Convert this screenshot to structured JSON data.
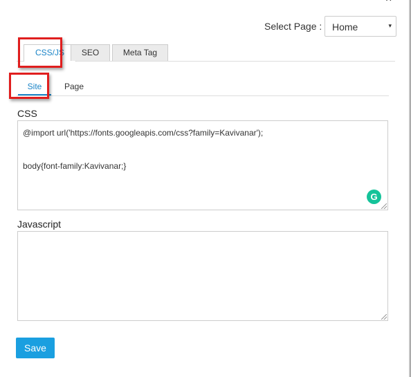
{
  "dialog": {
    "close_glyph": "×"
  },
  "page_select": {
    "label": "Select Page :",
    "value": "Home",
    "caret": "▾"
  },
  "tabs": [
    {
      "label": "CSS/JS",
      "active": true
    },
    {
      "label": "SEO",
      "active": false
    },
    {
      "label": "Meta Tag",
      "active": false
    }
  ],
  "subtabs": [
    {
      "label": "Site",
      "active": true
    },
    {
      "label": "Page",
      "active": false
    }
  ],
  "css": {
    "label": "CSS",
    "lines": [
      "@import url('https://fonts.googleapis.com/css?family=Kavivanar');",
      "",
      "",
      "body{font-family:Kavivanar;}"
    ]
  },
  "javascript": {
    "label": "Javascript",
    "value": ""
  },
  "grammarly": {
    "glyph": "G",
    "color": "#15c39a"
  },
  "save_button": {
    "label": "Save",
    "color": "#1a9fe0"
  },
  "highlight_color": "#e01e1e",
  "accent_color": "#1a84c7"
}
